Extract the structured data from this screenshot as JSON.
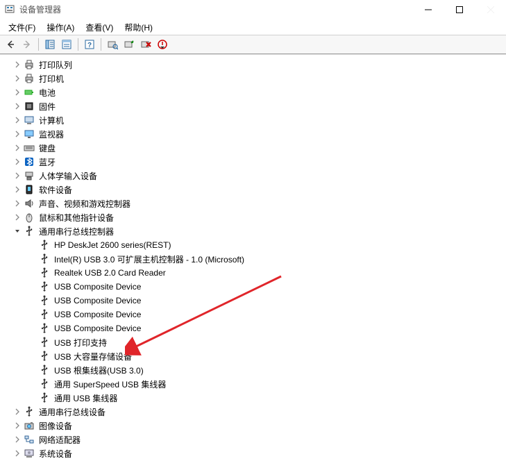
{
  "window": {
    "title": "设备管理器"
  },
  "menu": {
    "file": "文件(F)",
    "action": "操作(A)",
    "view": "查看(V)",
    "help": "帮助(H)"
  },
  "tree": [
    {
      "level": 1,
      "caret": "right",
      "icon": "print-queue-icon",
      "label": "打印队列"
    },
    {
      "level": 1,
      "caret": "right",
      "icon": "printer-icon",
      "label": "打印机"
    },
    {
      "level": 1,
      "caret": "right",
      "icon": "battery-icon",
      "label": "电池"
    },
    {
      "level": 1,
      "caret": "right",
      "icon": "firmware-icon",
      "label": "固件"
    },
    {
      "level": 1,
      "caret": "right",
      "icon": "computer-icon",
      "label": "计算机"
    },
    {
      "level": 1,
      "caret": "right",
      "icon": "monitor-icon",
      "label": "监视器"
    },
    {
      "level": 1,
      "caret": "right",
      "icon": "keyboard-icon",
      "label": "键盘"
    },
    {
      "level": 1,
      "caret": "right",
      "icon": "bluetooth-icon",
      "label": "蓝牙"
    },
    {
      "level": 1,
      "caret": "right",
      "icon": "hid-icon",
      "label": "人体学输入设备"
    },
    {
      "level": 1,
      "caret": "right",
      "icon": "software-device-icon",
      "label": "软件设备"
    },
    {
      "level": 1,
      "caret": "right",
      "icon": "audio-icon",
      "label": "声音、视频和游戏控制器"
    },
    {
      "level": 1,
      "caret": "right",
      "icon": "mouse-icon",
      "label": "鼠标和其他指针设备"
    },
    {
      "level": 1,
      "caret": "down",
      "icon": "usb-controller-icon",
      "label": "通用串行总线控制器"
    },
    {
      "level": 2,
      "caret": "none",
      "icon": "usb-device-icon",
      "label": "HP DeskJet 2600 series(REST)"
    },
    {
      "level": 2,
      "caret": "none",
      "icon": "usb-device-icon",
      "label": "Intel(R) USB 3.0 可扩展主机控制器 - 1.0 (Microsoft)"
    },
    {
      "level": 2,
      "caret": "none",
      "icon": "usb-device-icon",
      "label": "Realtek USB 2.0 Card Reader"
    },
    {
      "level": 2,
      "caret": "none",
      "icon": "usb-device-icon",
      "label": "USB Composite Device"
    },
    {
      "level": 2,
      "caret": "none",
      "icon": "usb-device-icon",
      "label": "USB Composite Device"
    },
    {
      "level": 2,
      "caret": "none",
      "icon": "usb-device-icon",
      "label": "USB Composite Device"
    },
    {
      "level": 2,
      "caret": "none",
      "icon": "usb-device-icon",
      "label": "USB Composite Device"
    },
    {
      "level": 2,
      "caret": "none",
      "icon": "usb-device-icon",
      "label": "USB 打印支持"
    },
    {
      "level": 2,
      "caret": "none",
      "icon": "usb-device-icon",
      "label": "USB 大容量存储设备"
    },
    {
      "level": 2,
      "caret": "none",
      "icon": "usb-device-icon",
      "label": "USB 根集线器(USB 3.0)"
    },
    {
      "level": 2,
      "caret": "none",
      "icon": "usb-device-icon",
      "label": "通用 SuperSpeed USB 集线器"
    },
    {
      "level": 2,
      "caret": "none",
      "icon": "usb-device-icon",
      "label": "通用 USB 集线器"
    },
    {
      "level": 1,
      "caret": "right",
      "icon": "usb-device-icon",
      "label": "通用串行总线设备"
    },
    {
      "level": 1,
      "caret": "right",
      "icon": "imaging-icon",
      "label": "图像设备"
    },
    {
      "level": 1,
      "caret": "right",
      "icon": "network-icon",
      "label": "网络适配器"
    },
    {
      "level": 1,
      "caret": "right",
      "icon": "system-device-icon",
      "label": "系统设备"
    }
  ]
}
